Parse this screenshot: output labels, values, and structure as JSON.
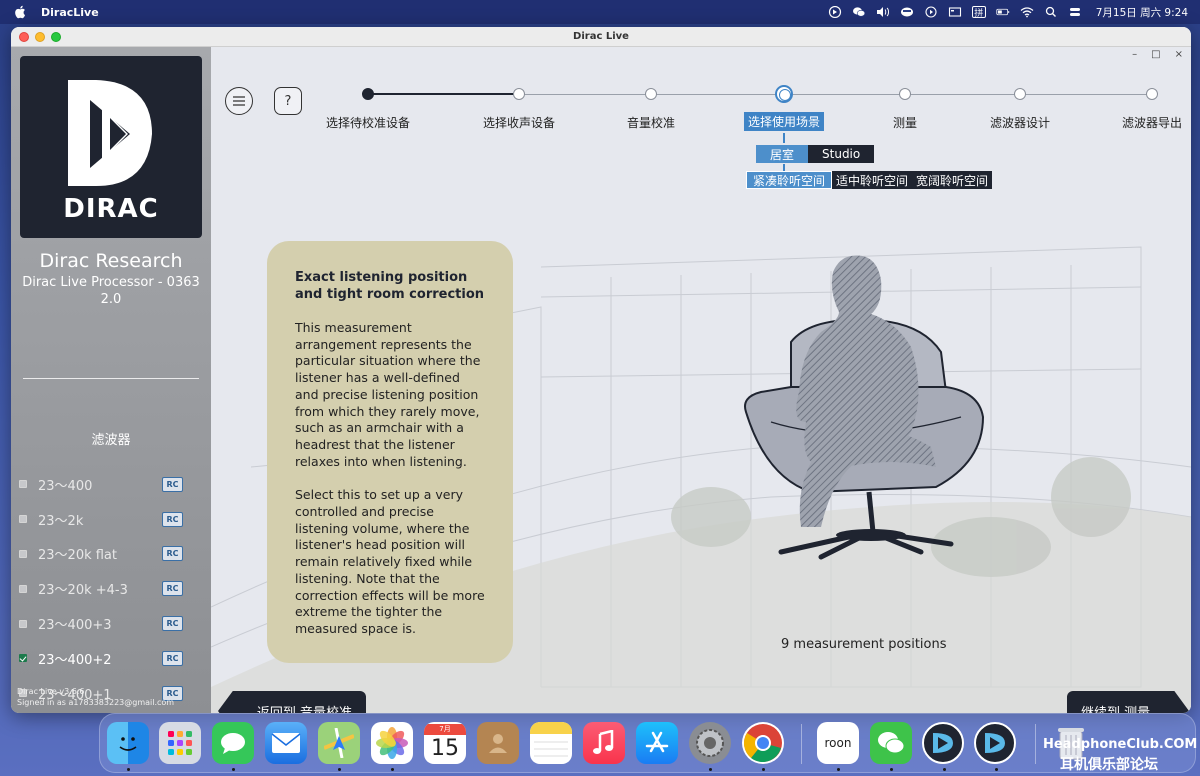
{
  "menubar": {
    "app_name": "DiracLive",
    "date_time": "7月15日 周六  9:24",
    "ime_label": "拼",
    "icons": [
      "dirac-menu-icon",
      "wechat-menu-icon",
      "volume-icon",
      "cloud-icon",
      "play-icon",
      "screen-icon",
      "ime-icon",
      "battery-icon",
      "wifi-icon",
      "search-icon",
      "control-center-icon"
    ]
  },
  "window": {
    "title": "Dirac Live",
    "controls": [
      "–",
      "□",
      "×"
    ]
  },
  "sidebar": {
    "logo_text": "DIRAC",
    "company": "Dirac Research",
    "processor": "Dirac Live Processor - 0363",
    "processor_version": "2.0",
    "filters_title": "滤波器",
    "filters": [
      {
        "name": "23～400",
        "checked": false,
        "badge": "RC"
      },
      {
        "name": "23～2k",
        "checked": false,
        "badge": "RC"
      },
      {
        "name": "23～20k flat",
        "checked": false,
        "badge": "RC"
      },
      {
        "name": "23～20k +4-3",
        "checked": false,
        "badge": "RC"
      },
      {
        "name": "23～400+3",
        "checked": false,
        "badge": "RC"
      },
      {
        "name": "23～400+2",
        "checked": true,
        "badge": "RC"
      },
      {
        "name": "23～400+1",
        "checked": false,
        "badge": "RC"
      }
    ],
    "app_version": "Dirac Live v3.6.6",
    "signed_in": "Signed in as a1783383223@gmail.com"
  },
  "toolbar": {
    "menu_icon": "hamburger-icon",
    "help_label": "?"
  },
  "steps": [
    {
      "label": "选择待校准设备",
      "state": "done"
    },
    {
      "label": "选择收声设备",
      "state": "pending"
    },
    {
      "label": "音量校准",
      "state": "pending"
    },
    {
      "label": "选择使用场景",
      "state": "current"
    },
    {
      "label": "测量",
      "state": "pending"
    },
    {
      "label": "滤波器设计",
      "state": "pending"
    },
    {
      "label": "滤波器导出",
      "state": "pending"
    }
  ],
  "scene_options": {
    "environment": [
      "居室",
      "Studio"
    ],
    "environment_selected": "居室",
    "space": [
      "紧凑聆听空间",
      "适中聆听空间",
      "宽阔聆听空间"
    ],
    "space_selected": "紧凑聆听空间"
  },
  "info_card": {
    "title": "Exact listening position and tight room correction",
    "paragraph1": "This measurement arrangement represents the particular situation where the listener has a well-defined and precise listening position from which they rarely move, such as an armchair with a headrest that the listener relaxes into when listening.",
    "paragraph2": "Select this to set up a very controlled and precise listening volume, where the listener's head position will remain relatively fixed while listening. Note that the correction effects will be more extreme the tighter the measured space is."
  },
  "measurement_caption": "9 measurement positions",
  "nav": {
    "back_label": "返回到 音量校准",
    "next_label": "继续到 测量"
  },
  "dock": {
    "apps": [
      "finder-icon",
      "launchpad-icon",
      "messages-icon",
      "mail-icon",
      "maps-icon",
      "photos-icon",
      "calendar-icon",
      "contacts-icon",
      "notes-icon",
      "music-icon",
      "app-store-icon",
      "system-settings-icon",
      "chrome-icon",
      "roon-icon",
      "wechat-icon",
      "dirac-icon",
      "dirac-icon-2",
      "trash-icon"
    ],
    "calendar_month": "7月",
    "calendar_day": "15",
    "roon_label": "roon"
  },
  "watermark": {
    "line1": "HeadphoneClub.COM",
    "line2": "耳机俱乐部论坛"
  },
  "colors": {
    "accent": "#3f84c6",
    "dark": "#1f2430",
    "card": "#d4cfae",
    "checked": "#1c7a4c"
  }
}
